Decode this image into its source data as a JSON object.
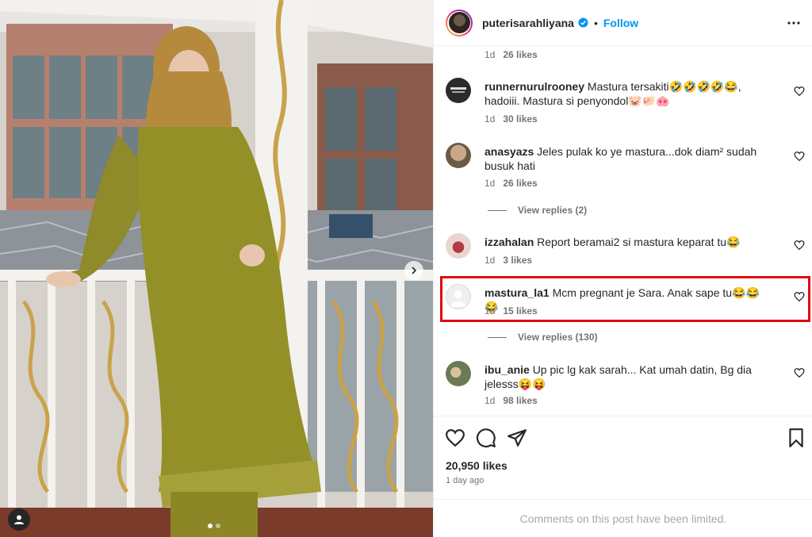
{
  "header": {
    "username": "puterisarahliyana",
    "follow_label": "Follow",
    "separator": "•"
  },
  "comments": {
    "top_meta": {
      "age": "1d",
      "likes": "26 likes"
    },
    "items": [
      {
        "user": "runnernurulrooney",
        "text": "Mastura tersakiti🤣🤣🤣🤣😂, hadoiii. Mastura si penyondol🐷🐖🐽",
        "age": "1d",
        "likes": "30 likes"
      },
      {
        "user": "anasyazs",
        "text": "Jeles pulak ko ye mastura...dok diam² sudah busuk hati",
        "age": "1d",
        "likes": "26 likes",
        "replies": "View replies (2)"
      },
      {
        "user": "izzahalan",
        "text": "Report beramai2 si mastura keparat tu😂",
        "age": "1d",
        "likes": "3 likes"
      },
      {
        "user": "mastura_la1",
        "text": "Mcm pregnant je Sara. Anak sape tu😂😂😂",
        "age": "1d",
        "likes": "15 likes",
        "replies": "View replies (130)"
      },
      {
        "user": "ibu_anie",
        "text": "Up pic lg kak sarah... Kat umah datin, Bg dia jelesss😝😝",
        "age": "1d",
        "likes": "98 likes"
      }
    ]
  },
  "post": {
    "likes": "20,950 likes",
    "time_ago": "1 day ago",
    "comments_limited": "Comments on this post have been limited."
  },
  "colors": {
    "follow_blue": "#0095f6",
    "highlight_red": "#e3050e",
    "muted_text": "#737373"
  },
  "icons": [
    "user-tag-icon",
    "chevron-right-icon",
    "verified-icon",
    "more-options-icon",
    "heart-icon",
    "comment-icon",
    "share-icon",
    "bookmark-icon"
  ]
}
